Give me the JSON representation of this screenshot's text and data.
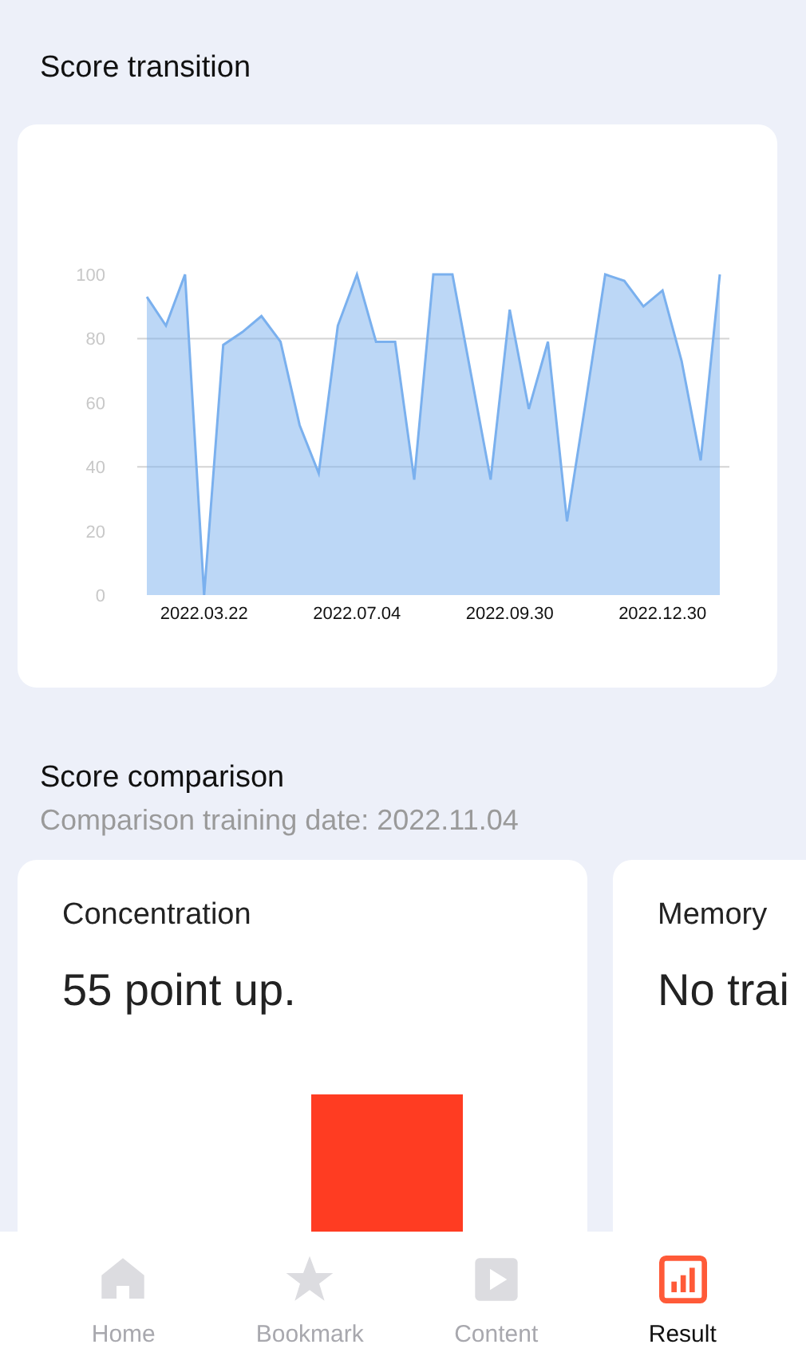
{
  "transition": {
    "title": "Score transition",
    "chart_data": {
      "type": "area",
      "categories": [
        null,
        null,
        null,
        "2022.03.22",
        null,
        null,
        null,
        null,
        null,
        null,
        null,
        "2022.07.04",
        null,
        null,
        null,
        null,
        null,
        null,
        null,
        "2022.09.30",
        null,
        null,
        null,
        null,
        null,
        null,
        null,
        "2022.12.30",
        null,
        null,
        null
      ],
      "series": [
        {
          "color": "#7ab0ee",
          "values": [
            93,
            84,
            100,
            0,
            78,
            82,
            87,
            79,
            53,
            38,
            84,
            100,
            79,
            79,
            36,
            100,
            100,
            68,
            36,
            89,
            58,
            79,
            23,
            61,
            100,
            98,
            90,
            95,
            73,
            42,
            100
          ]
        }
      ],
      "ylim": [
        0,
        100
      ],
      "yticks": [
        0,
        20,
        40,
        60,
        80,
        100
      ]
    }
  },
  "comparison": {
    "title": "Score comparison",
    "subtitle": "Comparison training date: 2022.11.04",
    "cards": [
      {
        "label": "Concentration",
        "result": "55 point up.",
        "bar": true
      },
      {
        "label": "Memory",
        "result": "No trai",
        "bar": false
      }
    ]
  },
  "tab_bar": [
    {
      "kind": "home",
      "label": "Home",
      "selected": false
    },
    {
      "kind": "star",
      "label": "Bookmark",
      "selected": false
    },
    {
      "kind": "play",
      "label": "Content",
      "selected": false
    },
    {
      "kind": "chart",
      "label": "Result",
      "selected": true
    }
  ]
}
